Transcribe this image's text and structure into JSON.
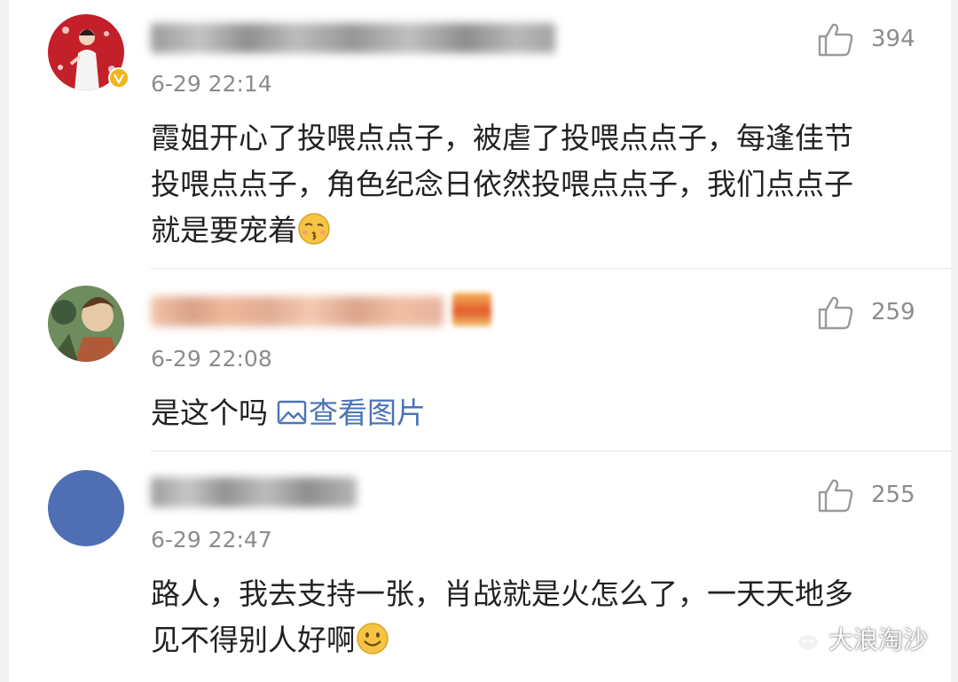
{
  "comments": [
    {
      "time": "6-29 22:14",
      "likes": "394",
      "text_lines": [
        "霞姐开心了投喂点点子，被虐了投喂点点子，每逢佳节",
        "投喂点点子，角色纪念日依然投喂点点子，我们点点子",
        "就是要宠着"
      ],
      "verified_badge_color": "#f2b51b",
      "emoji": "kiss-face-icon"
    },
    {
      "time": "6-29 22:08",
      "likes": "259",
      "text": "是这个吗",
      "link_text": "查看图片",
      "link_color": "#4a74b8"
    },
    {
      "time": "6-29 22:47",
      "likes": "255",
      "text_lines": [
        "路人，我去支持一张，肖战就是火怎么了，一天天地多",
        "见不得别人好啊"
      ],
      "avatar_color": "#4f6fb5",
      "emoji": "smile-face-icon"
    }
  ],
  "watermark": {
    "text": "大浪淘沙",
    "icon": "wechat-icon"
  }
}
